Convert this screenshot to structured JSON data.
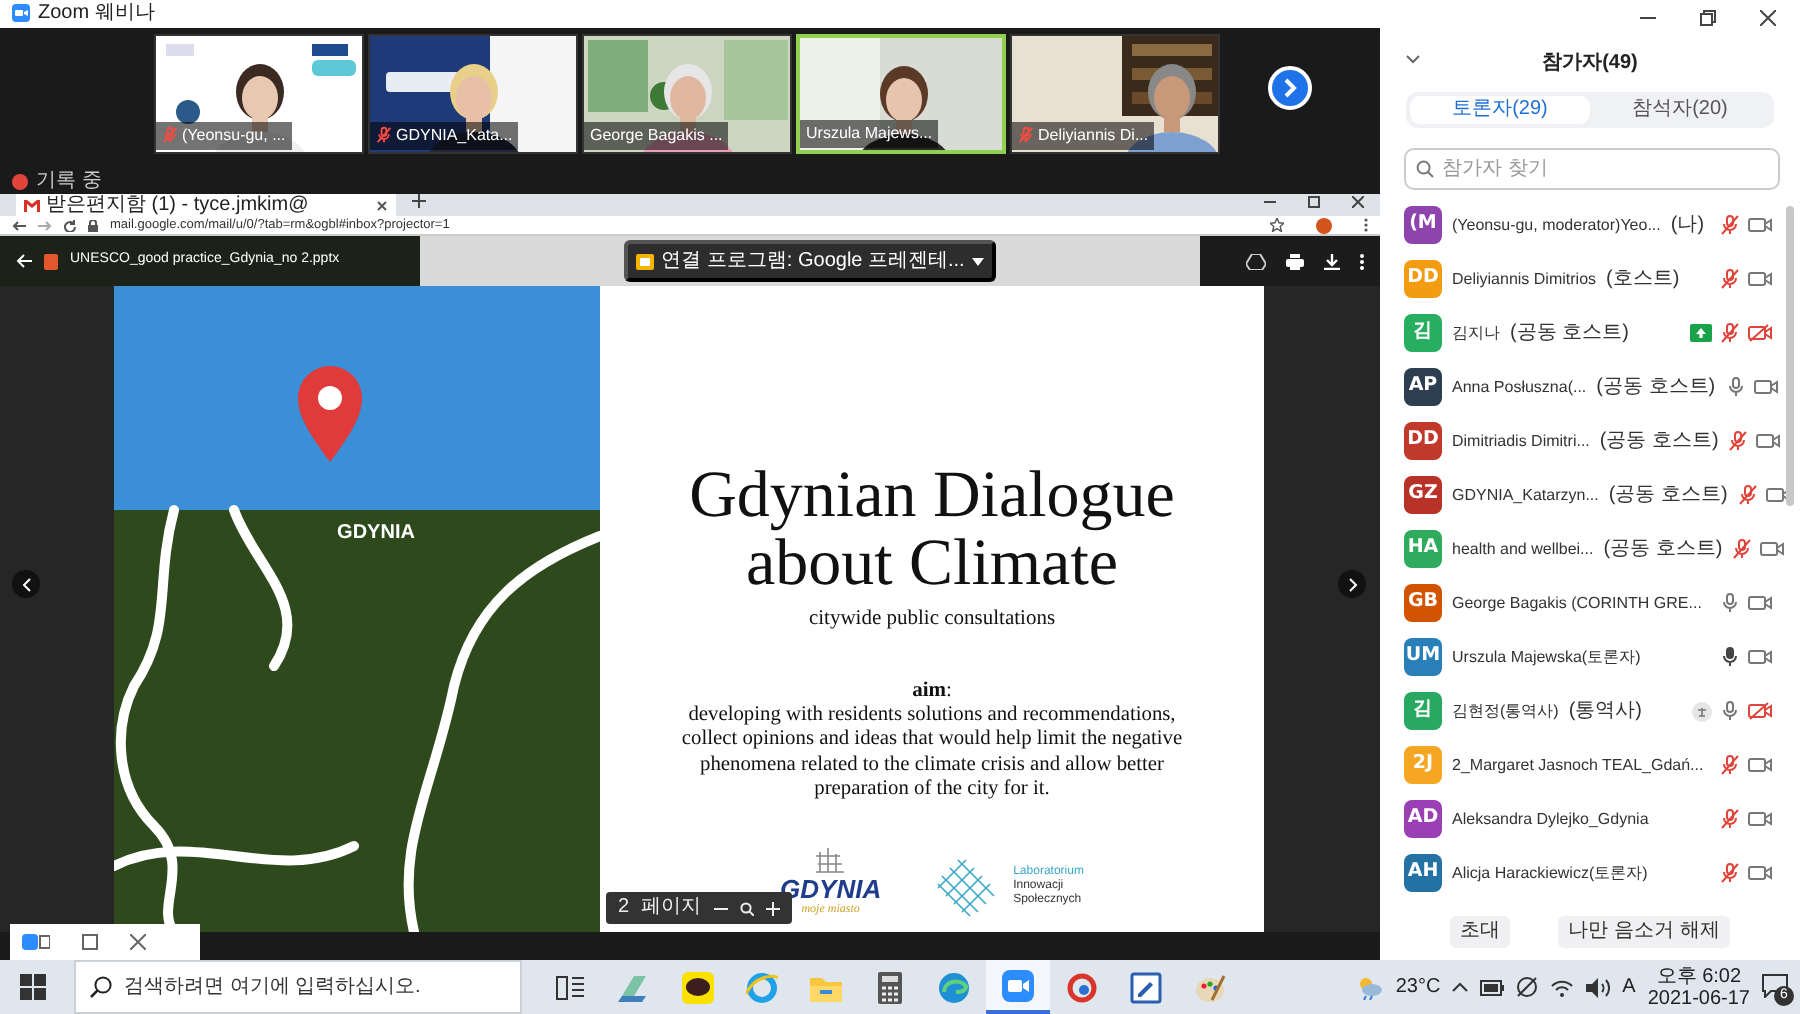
{
  "window": {
    "title": "Zoom 웨비나"
  },
  "video_strip": {
    "tiles": [
      {
        "name": "(Yeonsu-gu, ...",
        "muted": true,
        "active": false
      },
      {
        "name": "GDYNIA_Kata...",
        "muted": true,
        "active": false
      },
      {
        "name": "George Bagakis ...",
        "muted": false,
        "active": false
      },
      {
        "name": "Urszula Majews...",
        "muted": false,
        "active": true
      },
      {
        "name": "Deliyiannis Di...",
        "muted": true,
        "active": false
      }
    ]
  },
  "recording": {
    "label": "기록 중"
  },
  "browser": {
    "tab_title": "받은편지함 (1) - tyce.jmkim@",
    "address": "mail.google.com/mail/u/0/?tab=rm&ogbl#inbox?projector=1"
  },
  "viewer": {
    "file_name": "UNESCO_good practice_Gdynia_no 2.pptx",
    "open_with": "연결 프로그램: Google 프레젠테..."
  },
  "slide": {
    "map_label": "GDYNIA",
    "title": "Gdynian Dialogue about Climate",
    "subtitle": "citywide public consultations",
    "aim_label": "**aim**:",
    "aim_text": "developing with residents solutions and recommendations, collect opinions and ideas that would help limit the negative phenomena related to the climate crisis and allow better preparation of the city for it.",
    "city_logo": "GDYNIA",
    "city_tagline": "moje miasto",
    "lab_logo": [
      "Laboratorium",
      "Innowacji",
      "Społecznych"
    ]
  },
  "page_control": {
    "page": "2",
    "label": "페이지"
  },
  "participants": {
    "title": "참가자(49)",
    "tabs": [
      {
        "label": "토론자(29)",
        "selected": true
      },
      {
        "label": "참석자(20)",
        "selected": false
      }
    ],
    "search_placeholder": "참가자 찾기",
    "rows": [
      {
        "initials": "(M",
        "color": "#8e44ad",
        "name": "(Yeonsu-gu, moderator)Yeo...",
        "role": "(나)",
        "screen_sharing": false,
        "interpreter": false,
        "muted": true,
        "video": true
      },
      {
        "initials": "DD",
        "color": "#f39c12",
        "name": "Deliyiannis Dimitrios",
        "role": "(호스트)",
        "screen_sharing": false,
        "interpreter": false,
        "muted": true,
        "video": true
      },
      {
        "initials": "김",
        "color": "#27ae60",
        "name": "김지나",
        "role": "(공동 호스트)",
        "screen_sharing": true,
        "interpreter": false,
        "muted": true,
        "video": false
      },
      {
        "initials": "AP",
        "color": "#2c3e50",
        "name": "Anna Posłuszna(...",
        "role": "(공동 호스트)",
        "screen_sharing": false,
        "interpreter": false,
        "muted": false,
        "talking": false,
        "video": true
      },
      {
        "initials": "DD",
        "color": "#c0392b",
        "name": "Dimitriadis Dimitri...",
        "role": "(공동 호스트)",
        "screen_sharing": false,
        "interpreter": false,
        "muted": true,
        "video": true
      },
      {
        "initials": "GZ",
        "color": "#b83227",
        "name": "GDYNIA_Katarzyn...",
        "role": "(공동 호스트)",
        "screen_sharing": false,
        "interpreter": false,
        "muted": true,
        "video": true
      },
      {
        "initials": "HA",
        "color": "#2eab5c",
        "name": "health and wellbei...",
        "role": "(공동 호스트)",
        "screen_sharing": false,
        "interpreter": false,
        "muted": true,
        "video": true
      },
      {
        "initials": "GB",
        "color": "#d35400",
        "name": "George Bagakis (CORINTH GRE...",
        "screen_sharing": false,
        "interpreter": false,
        "muted": false,
        "talking": false,
        "video": true
      },
      {
        "initials": "UM",
        "color": "#2980b9",
        "name": "Urszula Majewska(토론자)",
        "screen_sharing": false,
        "interpreter": false,
        "muted": false,
        "talking": true,
        "video": true
      },
      {
        "initials": "김",
        "color": "#28a860",
        "name": "김현정(통역사)",
        "role": "(통역사)",
        "screen_sharing": false,
        "interpreter": true,
        "muted": false,
        "talking": false,
        "video": false
      },
      {
        "initials": "2J",
        "color": "#f5a623",
        "name": "2_Margaret Jasnoch TEAL_Gdań...",
        "screen_sharing": false,
        "interpreter": false,
        "muted": true,
        "video": true
      },
      {
        "initials": "AD",
        "color": "#9b3fb5",
        "name": "Aleksandra Dylejko_Gdynia",
        "screen_sharing": false,
        "interpreter": false,
        "muted": true,
        "video": true
      },
      {
        "initials": "AH",
        "color": "#2471a3",
        "name": "Alicja Harackiewicz(토론자)",
        "screen_sharing": false,
        "interpreter": false,
        "muted": true,
        "video": true
      }
    ],
    "buttons": [
      "초대",
      "나만 음소거 해제"
    ]
  },
  "taskbar": {
    "search_placeholder": "검색하려면 여기에 입력하십시오.",
    "apps": [
      {
        "kind": "taskview",
        "active": false
      },
      {
        "kind": "drive",
        "active": false
      },
      {
        "kind": "chat",
        "active": false
      },
      {
        "kind": "ie",
        "active": false
      },
      {
        "kind": "folder",
        "active": false
      },
      {
        "kind": "calculator",
        "active": false
      },
      {
        "kind": "edge",
        "active": false
      },
      {
        "kind": "zoom",
        "active": true
      },
      {
        "kind": "tool",
        "active": false
      },
      {
        "kind": "note",
        "active": false
      },
      {
        "kind": "paint",
        "active": false
      }
    ],
    "temperature": "23°C",
    "ime": "A",
    "time": "오후 6:02",
    "date": "2021-06-17",
    "notifications": "6"
  }
}
